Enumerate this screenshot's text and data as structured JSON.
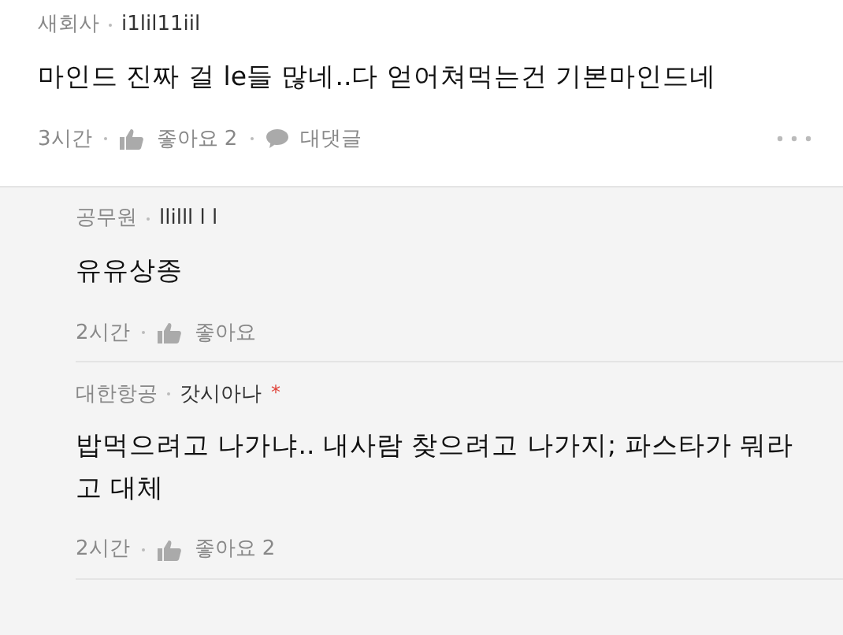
{
  "comments": [
    {
      "kind": "comment",
      "company": "새회사",
      "nickname": "i1lil11iil",
      "text": "마인드 진짜 걸 le들 많네..다 얻어쳐먹는건 기본마인드네",
      "time": "3시간",
      "likes": "좋아요 2",
      "reply": "대댓글"
    },
    {
      "kind": "reply",
      "company": "공무원",
      "nickname": "llilll l l",
      "text": "유유상종",
      "time": "2시간",
      "likes": "좋아요"
    },
    {
      "kind": "reply",
      "company": "대한항공",
      "nickname": "갓시아나",
      "mark": "*",
      "text": "밥먹으려고 나가냐.. 내사람 찾으려고 나가지; 파스타가 뭐라고 대체",
      "time": "2시간",
      "likes": "좋아요 2"
    }
  ]
}
